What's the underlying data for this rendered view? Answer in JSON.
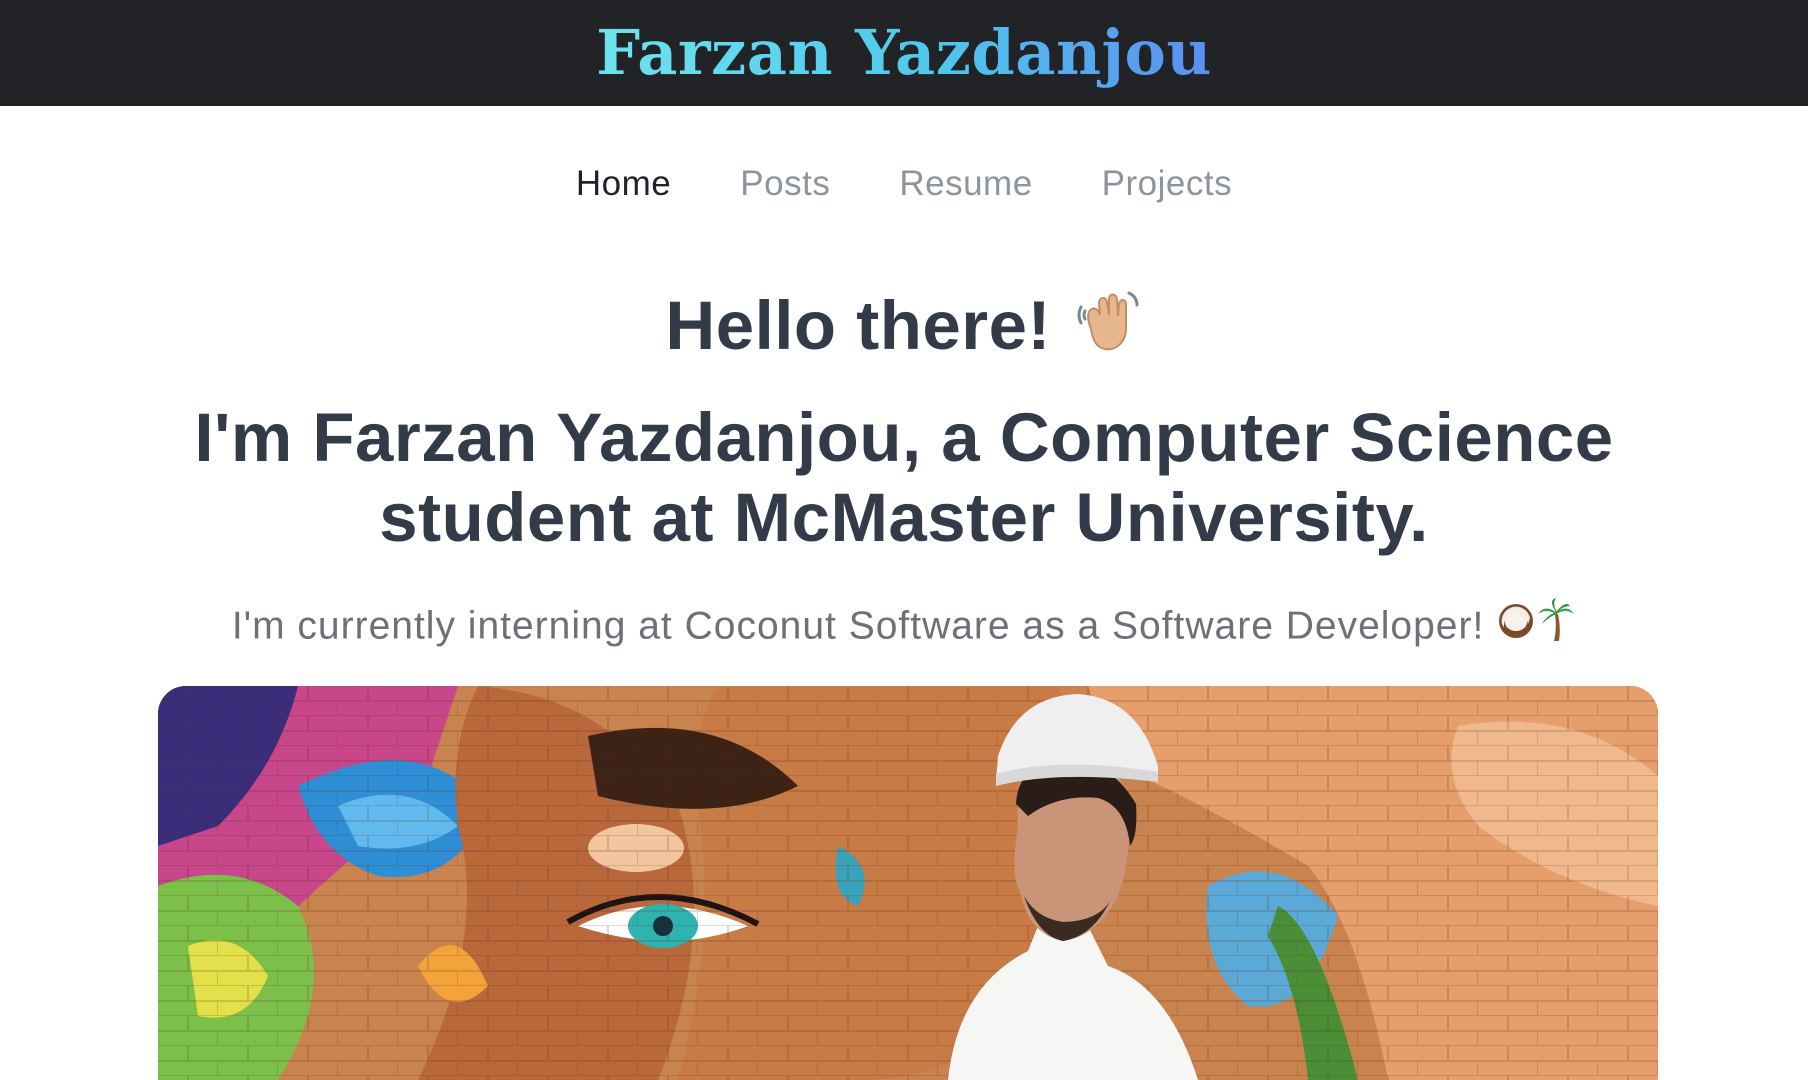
{
  "header": {
    "site_title": "Farzan Yazdanjou",
    "background_color": "#212326"
  },
  "nav": {
    "items": [
      {
        "label": "Home",
        "active": true
      },
      {
        "label": "Posts",
        "active": false
      },
      {
        "label": "Resume",
        "active": false
      },
      {
        "label": "Projects",
        "active": false
      }
    ]
  },
  "hero": {
    "greeting": "Hello there!",
    "greeting_emoji": "waving-hand",
    "intro": "I'm Farzan Yazdanjou, a Computer Science student at McMaster University.",
    "subline": "I'm currently interning at Coconut Software as a Software Developer!",
    "subline_emojis": [
      "coconut",
      "palm-tree"
    ]
  },
  "photo": {
    "subject": "profile-photo-graffiti-wall"
  }
}
